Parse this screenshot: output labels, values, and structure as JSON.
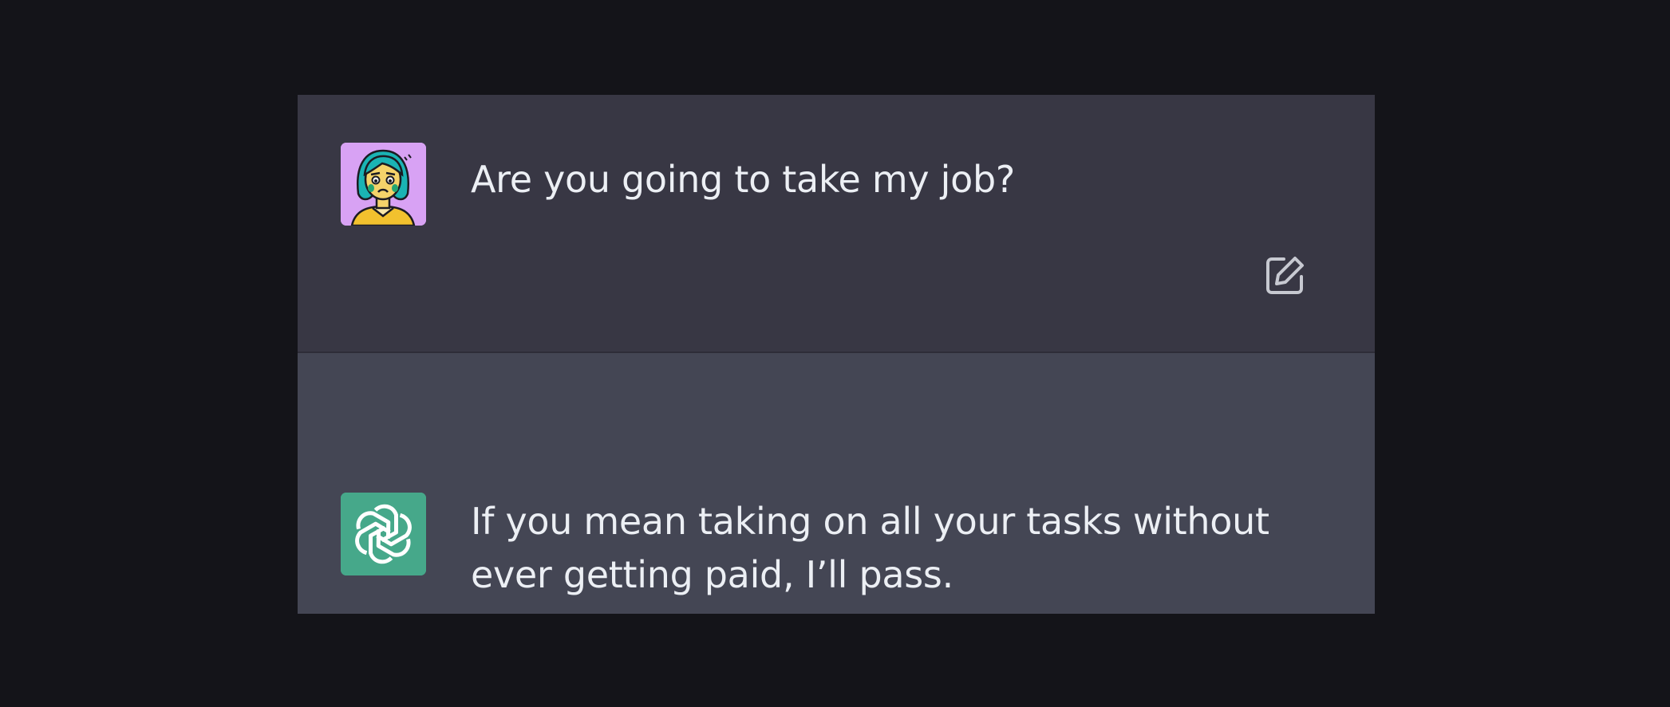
{
  "conversation": {
    "user_message": {
      "avatar": "worried-woman-avatar",
      "text": "Are you going to take my job?",
      "edit_icon": "edit-icon"
    },
    "assistant_message": {
      "avatar": "openai-logo-avatar",
      "text": "If you mean taking on all your tasks without ever getting paid, I’ll pass."
    }
  },
  "colors": {
    "page_background": "#141419",
    "user_row_background": "#383744",
    "assistant_row_background": "#444654",
    "text": "#eceff4",
    "user_avatar_background": "#d8a2f4",
    "assistant_avatar_background": "#46a88a"
  }
}
